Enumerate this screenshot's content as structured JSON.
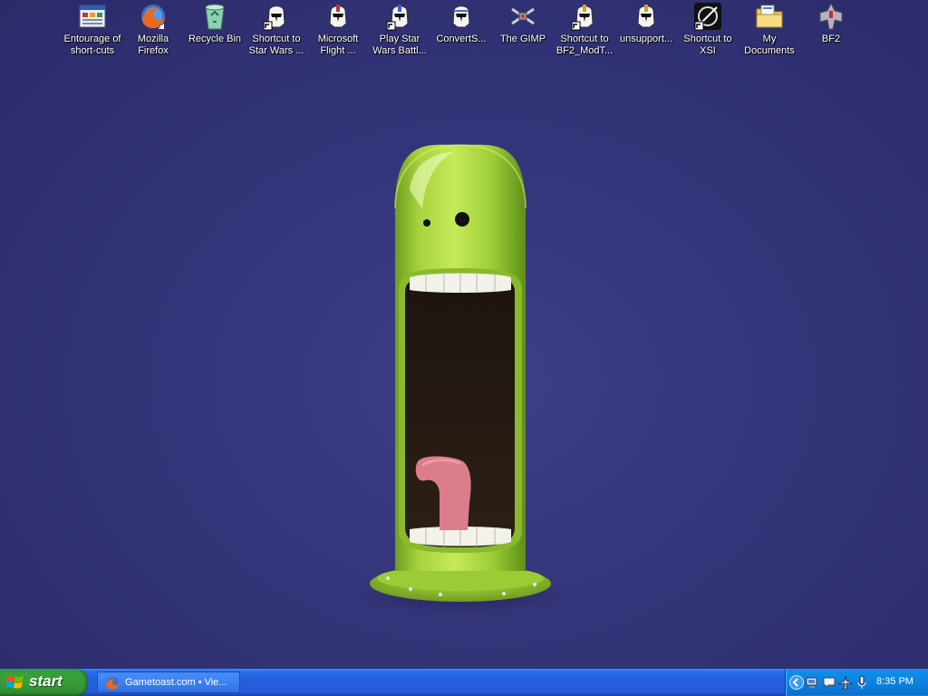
{
  "desktop": {
    "icons": [
      {
        "label": "Entourage of\nshort-cuts",
        "icon": "window-app-icon"
      },
      {
        "label": "Mozilla\nFirefox",
        "icon": "firefox-icon"
      },
      {
        "label": "Recycle Bin",
        "icon": "recycle-bin-icon"
      },
      {
        "label": "Shortcut to\nStar Wars ...",
        "icon": "clone-trooper-icon"
      },
      {
        "label": "Microsoft\nFlight ...",
        "icon": "clone-trooper-red-icon"
      },
      {
        "label": "Play Star\nWars Battl...",
        "icon": "clone-trooper-blue-icon"
      },
      {
        "label": "ConvertS...",
        "icon": "clone-trooper-blue-icon"
      },
      {
        "label": "The GIMP",
        "icon": "xwing-icon"
      },
      {
        "label": "Shortcut to\nBF2_ModT...",
        "icon": "clone-trooper-yellow-icon"
      },
      {
        "label": "unsupport...",
        "icon": "clone-trooper-yellow-icon"
      },
      {
        "label": "Shortcut to\nXSI",
        "icon": "xsi-icon"
      },
      {
        "label": "My\nDocuments",
        "icon": "folder-icon"
      },
      {
        "label": "BF2",
        "icon": "starfighter-icon"
      }
    ]
  },
  "taskbar": {
    "start_label": "start",
    "tasks": [
      {
        "label": "Gametoast.com • Vie...",
        "icon": "firefox-icon"
      }
    ],
    "tray": {
      "icons": [
        "network-icon",
        "messenger-icon",
        "airplane-icon",
        "microphone-icon"
      ],
      "clock": "8:35 PM"
    }
  },
  "colors": {
    "wallpaper": "#34347a",
    "character_green": "#8dc63f",
    "taskbar_blue": "#245edb",
    "start_green": "#3a9c3a"
  }
}
